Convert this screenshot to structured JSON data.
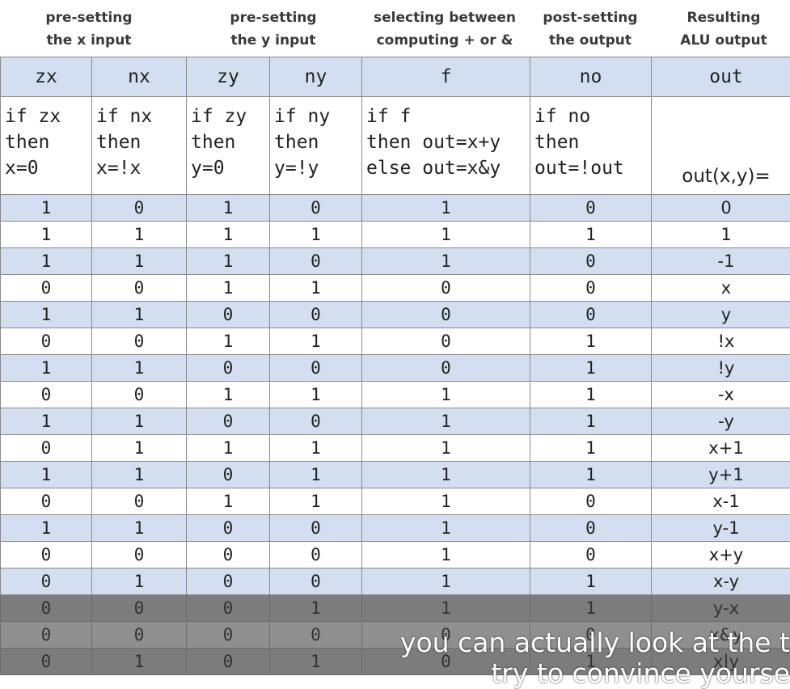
{
  "groups": [
    {
      "line1": "pre-setting",
      "line2": "the x input"
    },
    {
      "line1": "pre-setting",
      "line2": "the y input"
    },
    {
      "line1": "selecting between",
      "line2": "computing + or &"
    },
    {
      "line1": "post-setting",
      "line2": "the output"
    },
    {
      "line1": "Resulting",
      "line2": "ALU output"
    }
  ],
  "headers": [
    "zx",
    "nx",
    "zy",
    "ny",
    "f",
    "no",
    "out"
  ],
  "descriptions": [
    "if zx\nthen\nx=0",
    "if nx\nthen\nx=!x",
    "if zy\nthen\ny=0",
    "if ny\nthen\ny=!y",
    "if f\nthen out=x+y\nelse out=x&y",
    "if no\nthen\nout=!out",
    "out(x,y)="
  ],
  "rows": [
    [
      "1",
      "0",
      "1",
      "0",
      "1",
      "0",
      "0"
    ],
    [
      "1",
      "1",
      "1",
      "1",
      "1",
      "1",
      "1"
    ],
    [
      "1",
      "1",
      "1",
      "0",
      "1",
      "0",
      "-1"
    ],
    [
      "0",
      "0",
      "1",
      "1",
      "0",
      "0",
      "x"
    ],
    [
      "1",
      "1",
      "0",
      "0",
      "0",
      "0",
      "y"
    ],
    [
      "0",
      "0",
      "1",
      "1",
      "0",
      "1",
      "!x"
    ],
    [
      "1",
      "1",
      "0",
      "0",
      "0",
      "1",
      "!y"
    ],
    [
      "0",
      "0",
      "1",
      "1",
      "1",
      "1",
      "-x"
    ],
    [
      "1",
      "1",
      "0",
      "0",
      "1",
      "1",
      "-y"
    ],
    [
      "0",
      "1",
      "1",
      "1",
      "1",
      "1",
      "x+1"
    ],
    [
      "1",
      "1",
      "0",
      "1",
      "1",
      "1",
      "y+1"
    ],
    [
      "0",
      "0",
      "1",
      "1",
      "1",
      "0",
      "x-1"
    ],
    [
      "1",
      "1",
      "0",
      "0",
      "1",
      "0",
      "y-1"
    ],
    [
      "0",
      "0",
      "0",
      "0",
      "1",
      "0",
      "x+y"
    ],
    [
      "0",
      "1",
      "0",
      "0",
      "1",
      "1",
      "x-y"
    ],
    [
      "0",
      "0",
      "0",
      "1",
      "1",
      "1",
      "y-x"
    ],
    [
      "0",
      "0",
      "0",
      "0",
      "0",
      "0",
      "x&y"
    ],
    [
      "0",
      "1",
      "0",
      "1",
      "0",
      "1",
      "x|y"
    ]
  ],
  "caption": {
    "line1": "you can actually look at the t",
    "line2": "try to convince yourse"
  }
}
